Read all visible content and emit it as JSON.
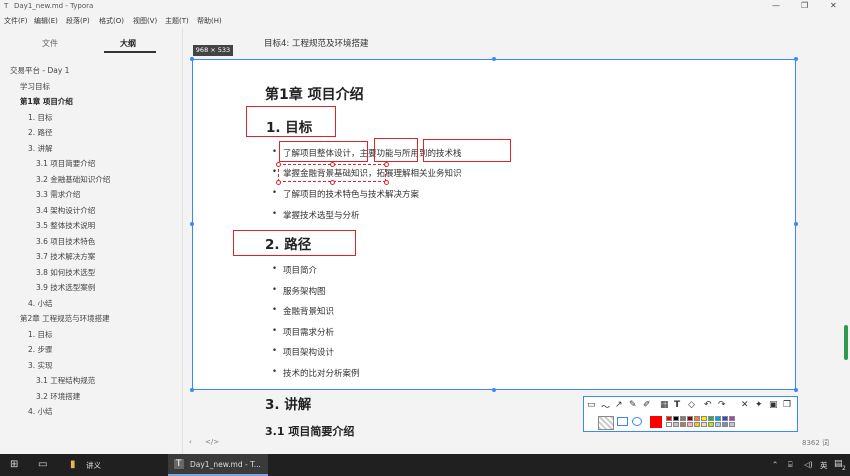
{
  "window": {
    "title": "Day1_new.md - Typora"
  },
  "menu": [
    "文件(F)",
    "编辑(E)",
    "段落(P)",
    "格式(O)",
    "视图(V)",
    "主题(T)",
    "帮助(H)"
  ],
  "sidebar": {
    "tabs": [
      "文件",
      "大纲"
    ],
    "active_tab": "大纲",
    "outline": [
      "交易平台 - Day 1",
      "学习目标",
      "第1章 项目介绍",
      "1. 目标",
      "2. 路径",
      "3. 讲解",
      "3.1 项目简要介绍",
      "3.2 金融基础知识介绍",
      "3.3 需求介绍",
      "3.4 架构设计介绍",
      "3.5 整体技术说明",
      "3.6 项目技术特色",
      "3.7 技术解决方案",
      "3.8 如何技术选型",
      "3.9 技术选型案例",
      "4. 小结",
      "第2章 工程规范与环境搭建",
      "1. 目标",
      "2. 步骤",
      "3. 实现",
      "3.1 工程结构规范",
      "3.2 环境搭建",
      "4. 小结"
    ]
  },
  "editor": {
    "above_capture": "目标4:  工程规范及环境搭建",
    "size_badge": "968 × 533",
    "chapter_title": "第1章 项目介绍",
    "sec1_title": "1. 目标",
    "goals": [
      "了解项目整体设计，主要功能与所用到的技术栈",
      "掌握金融背景基础知识，拓展理解相关业务知识",
      "了解项目的技术特色与技术解决方案",
      "掌握技术选型与分析"
    ],
    "sec2_title": "2. 路径",
    "paths": [
      "项目简介",
      "服务架构图",
      "金融背景知识",
      "项目需求分析",
      "项目架构设计",
      "技术的比对分析案例"
    ],
    "sec3_title": "3. 讲解",
    "sec31_title": "3.1 项目简要介绍"
  },
  "toolbar_icons": [
    "rect-select-icon",
    "pen-icon",
    "arrow-icon",
    "brush-icon",
    "marker-icon",
    "mosaic-icon",
    "text-icon",
    "eraser-icon",
    "undo-icon",
    "redo-icon",
    "close-icon",
    "pin-icon",
    "save-icon",
    "copy-icon"
  ],
  "palette": [
    "#ff0000",
    "#000000",
    "#7f7f7f",
    "#880015",
    "#ff7f27",
    "#fff200",
    "#22b14c",
    "#00a2e8",
    "#3f48cc",
    "#a349a4",
    "#ffffff",
    "#c3c3c3",
    "#b97a57",
    "#ffaec9",
    "#ffc90e",
    "#efe4b0",
    "#b5e61d",
    "#99d9ea",
    "#7092be",
    "#c8bfe7"
  ],
  "status": {
    "word_count": "8362 词"
  },
  "taskbar": {
    "items": [
      "讲义",
      "Day1_new.md - T..."
    ],
    "tray_time": "",
    "notify_count": "2"
  }
}
